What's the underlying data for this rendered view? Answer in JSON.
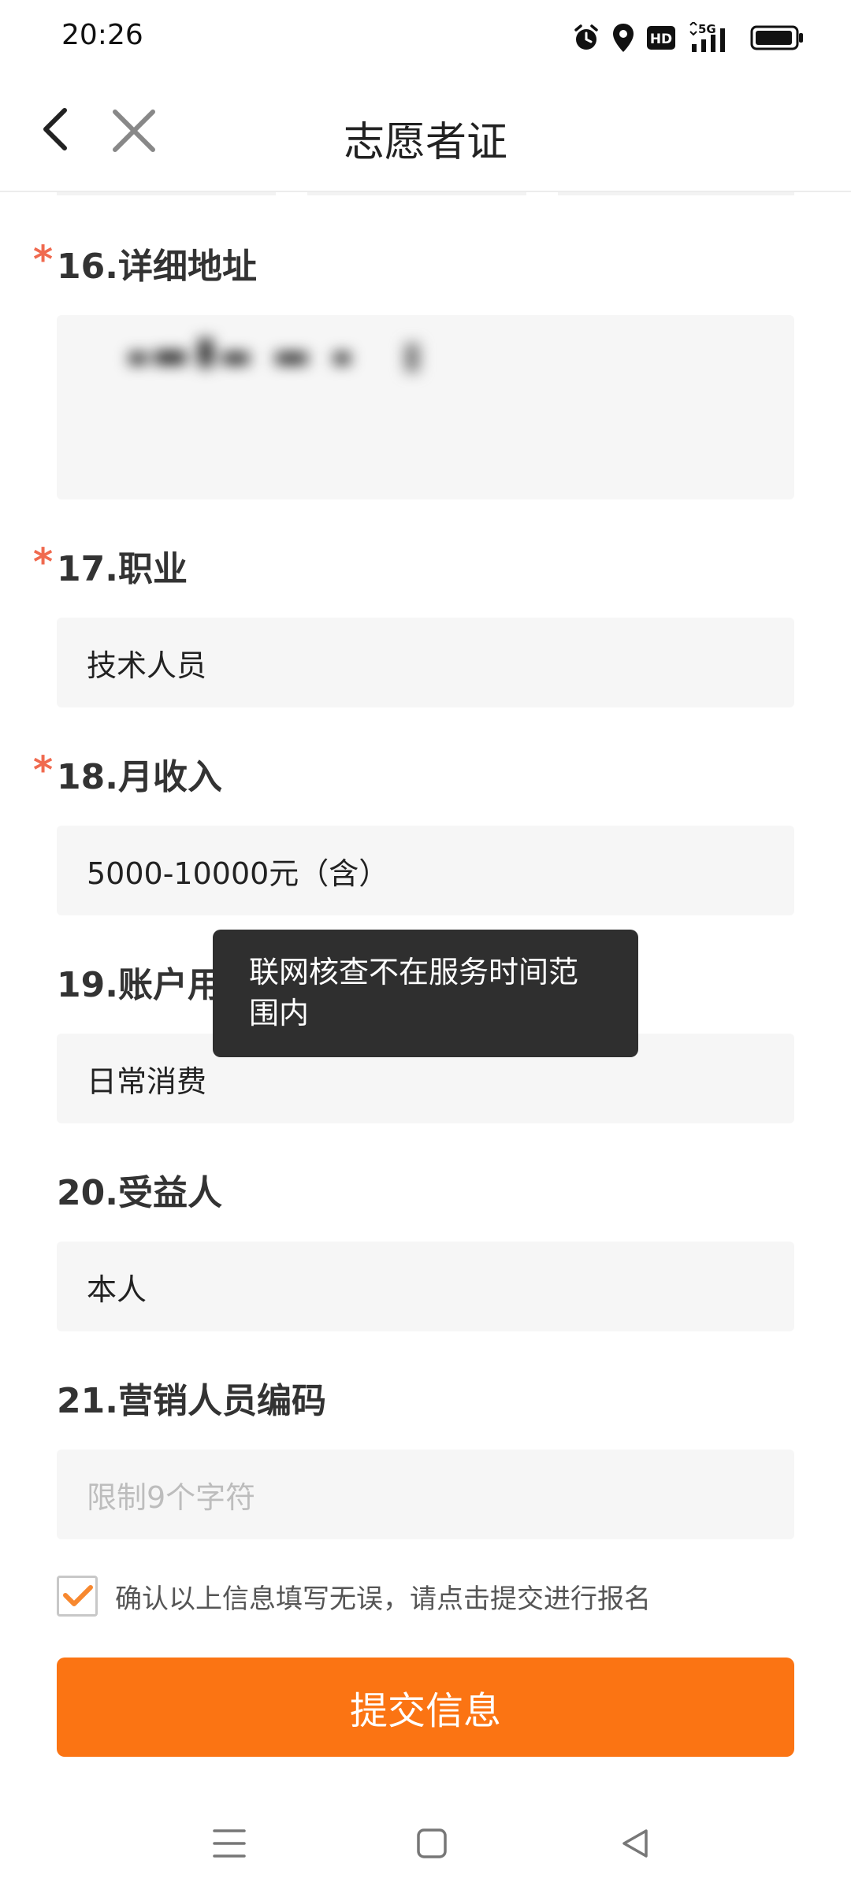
{
  "status_bar": {
    "time": "20:26",
    "icons": [
      "alarm-icon",
      "location-icon",
      "hd-icon",
      "5g-signal-icon",
      "battery-icon"
    ],
    "hd_label": "HD",
    "network_label": "5G"
  },
  "nav": {
    "title": "志愿者证",
    "back_icon": "chevron-left-icon",
    "close_icon": "close-icon"
  },
  "form": {
    "required_mark": "*",
    "fields": [
      {
        "label": "16.详细地址",
        "required": true,
        "value": ""
      },
      {
        "label": "17.职业",
        "required": true,
        "value": "技术人员"
      },
      {
        "label": "18.月收入",
        "required": true,
        "value": "5000-10000元（含）"
      },
      {
        "label": "19.账户用途",
        "required": false,
        "value": "日常消费"
      },
      {
        "label": "20.受益人",
        "required": false,
        "value": "本人"
      },
      {
        "label": "21.营销人员编码",
        "required": false,
        "value": "",
        "placeholder": "限制9个字符"
      }
    ]
  },
  "confirm": {
    "checked": true,
    "text": "确认以上信息填写无误，请点击提交进行报名"
  },
  "submit_label": "提交信息",
  "toast": {
    "line1": "联网核查不在服务时间范",
    "line2": "围内"
  },
  "colors": {
    "accent": "#fb7413",
    "required": "#f06a4f",
    "check": "#f7882f",
    "field_bg": "#f6f6f6",
    "toast_bg": "#2f2f2f"
  }
}
